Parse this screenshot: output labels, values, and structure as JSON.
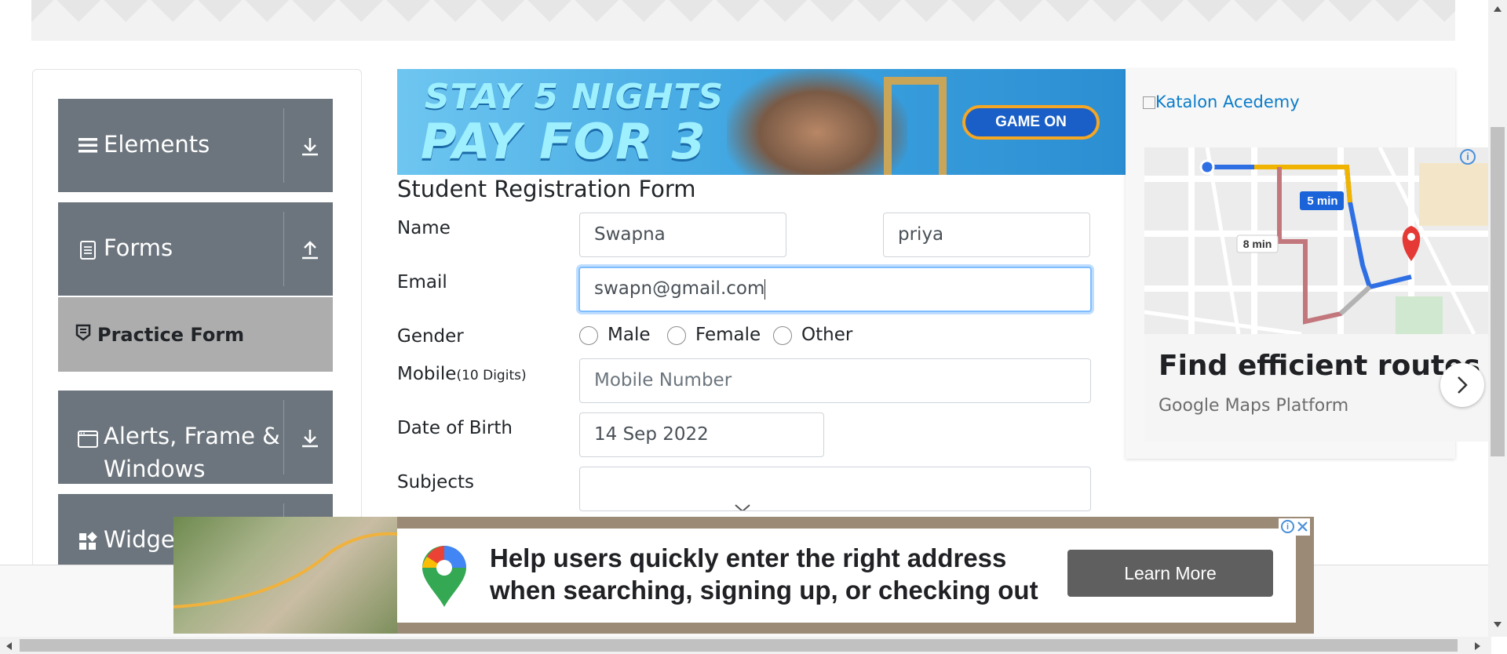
{
  "sidebar": {
    "groups": [
      {
        "label": "Elements",
        "icon": "menu-icon",
        "arrow": "download-arrow-icon"
      },
      {
        "label": "Forms",
        "icon": "document-icon",
        "arrow": "upload-arrow-icon"
      },
      {
        "label": "Alerts, Frame &",
        "label2": "Windows",
        "icon": "window-icon",
        "arrow": "download-arrow-icon"
      },
      {
        "label": "Widget",
        "icon": "widgets-icon"
      }
    ],
    "active_item": "Practice Form"
  },
  "banner": {
    "line1": "STAY 5 NIGHTS",
    "line2": "PAY FOR 3",
    "button": "GAME ON"
  },
  "form": {
    "title": "Student Registration Form",
    "name_label": "Name",
    "first_name": "Swapna",
    "last_name": "priya",
    "email_label": "Email",
    "email": "swapn@gmail.com",
    "gender_label": "Gender",
    "gender_options": [
      "Male",
      "Female",
      "Other"
    ],
    "mobile_label": "Mobile",
    "mobile_hint": "(10 Digits)",
    "mobile_placeholder": "Mobile Number",
    "dob_label": "Date of Birth",
    "dob": "14 Sep 2022",
    "subjects_label": "Subjects"
  },
  "right_ad": {
    "image_alt": "Katalon Acedemy",
    "route_time_1": "5 min",
    "route_time_2": "8 min",
    "headline": "Find efficient routes",
    "sub": "Google Maps Platform"
  },
  "bottom_ad": {
    "line1": "Help users quickly enter the right address",
    "line2": "when searching, signing up, or checking out",
    "cta": "Learn More"
  },
  "colors": {
    "sidebar_group": "#6c757d",
    "active_item": "#adadad",
    "focus_border": "#80bdff",
    "cta": "#5f5f5f"
  }
}
